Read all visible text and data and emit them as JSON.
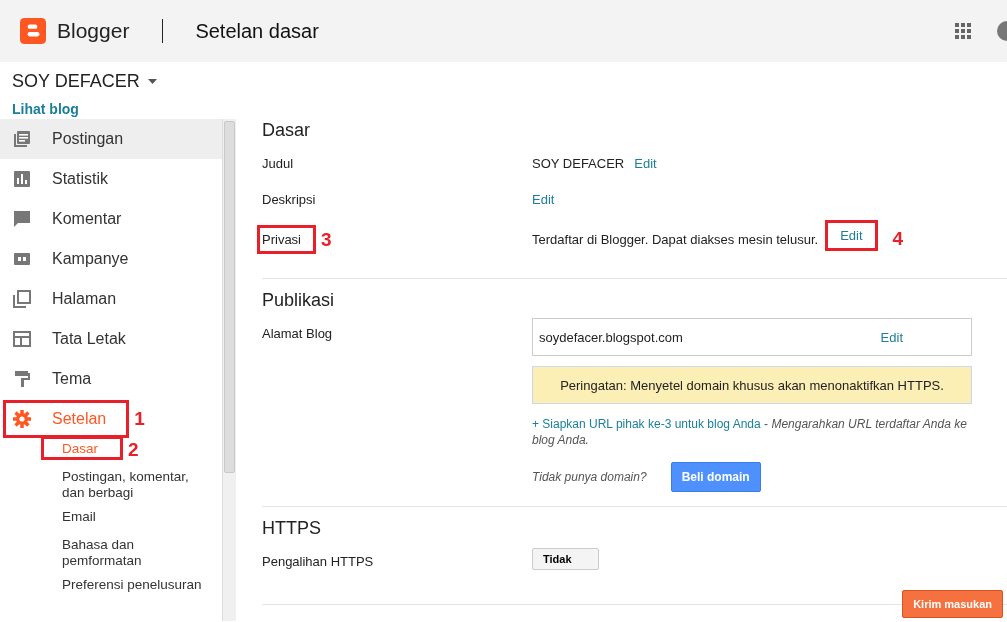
{
  "header": {
    "brand": "Blogger",
    "page_title": "Setelan dasar"
  },
  "blog": {
    "name": "SOY DEFACER",
    "view_link": "Lihat blog"
  },
  "nav": [
    {
      "label": "Postingan",
      "kind": "posts",
      "selected": false,
      "hover": true
    },
    {
      "label": "Statistik",
      "kind": "stats",
      "selected": false,
      "hover": false
    },
    {
      "label": "Komentar",
      "kind": "comments",
      "selected": false,
      "hover": false
    },
    {
      "label": "Kampanye",
      "kind": "ads",
      "selected": false,
      "hover": false
    },
    {
      "label": "Halaman",
      "kind": "pages",
      "selected": false,
      "hover": false
    },
    {
      "label": "Tata Letak",
      "kind": "layout",
      "selected": false,
      "hover": false
    },
    {
      "label": "Tema",
      "kind": "theme",
      "selected": false,
      "hover": false
    },
    {
      "label": "Setelan",
      "kind": "settings",
      "selected": true,
      "hover": false,
      "annotation": "1",
      "children": [
        {
          "label": "Dasar",
          "selected": true,
          "annotation": "2"
        },
        {
          "label": "Postingan, komentar, dan berbagi",
          "selected": false
        },
        {
          "label": "Email",
          "selected": false
        },
        {
          "label": "Bahasa dan pemformatan",
          "selected": false
        },
        {
          "label": "Preferensi penelusuran",
          "selected": false
        }
      ]
    }
  ],
  "sections": [
    {
      "title": "Dasar",
      "rows": [
        {
          "kind": "text",
          "label": "Judul",
          "value": "SOY DEFACER",
          "link": "Edit"
        },
        {
          "kind": "text",
          "label": "Deskripsi",
          "link": "Edit"
        },
        {
          "kind": "text",
          "label": "Privasi",
          "label_annotation": "3",
          "value": "Terdaftar di Blogger. Dapat diakses mesin telusur.",
          "link": "Edit",
          "link_annotation": "4"
        }
      ]
    },
    {
      "title": "Publikasi",
      "rows": [
        {
          "kind": "address",
          "label": "Alamat Blog",
          "value": "soydefacer.blogspot.com",
          "link": "Edit",
          "warning": "Peringatan: Menyetel domain khusus akan menonaktifkan HTTPS.",
          "setup_link": "+ Siapkan URL pihak ke-3 untuk blog Anda",
          "setup_note": "- *Mengarahkan URL terdaftar Anda ke blog Anda.*",
          "prompt": "Tidak punya domain?",
          "button": "Beli domain"
        }
      ]
    },
    {
      "title": "HTTPS",
      "rows": [
        {
          "kind": "select",
          "label": "Pengalihan HTTPS",
          "value": "Tidak"
        }
      ]
    }
  ],
  "feedback_button": "Kirim masukan"
}
